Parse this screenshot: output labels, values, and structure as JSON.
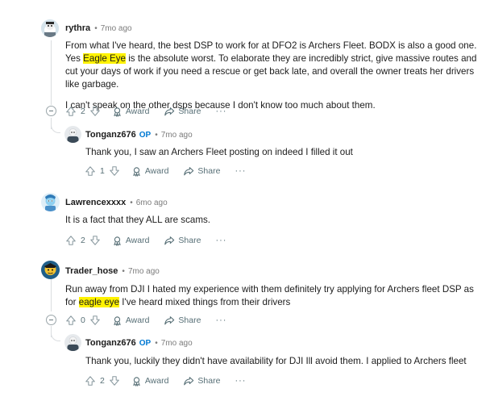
{
  "comments": [
    {
      "author": "rythra",
      "op": "",
      "time": "7mo ago",
      "paragraph1_before": "From what I've heard, the best DSP to work for at DFO2 is Archers Fleet. BODX is also a good one. Yes ",
      "paragraph1_highlight": "Eagle Eye",
      "paragraph1_after": " is the absolute worst. To elaborate they are incredibly strict, give massive routes and cut your days of work if you need a rescue or get back late, and overall the owner treats her drivers like garbage.",
      "paragraph2": "I can't speak on the other dsps because I don't know too much about them.",
      "votes": "2",
      "award_label": "Award",
      "share_label": "Share",
      "more_label": "···"
    },
    {
      "author": "Tonganz676",
      "op": "OP",
      "time": "7mo ago",
      "text": "Thank you, I saw an Archers Fleet posting on indeed I filled it out",
      "votes": "1",
      "award_label": "Award",
      "share_label": "Share",
      "more_label": "···"
    },
    {
      "author": "Lawrencexxxx",
      "op": "",
      "time": "6mo ago",
      "text": "It is a fact that they ALL are scams.",
      "votes": "2",
      "award_label": "Award",
      "share_label": "Share",
      "more_label": "···"
    },
    {
      "author": "Trader_hose",
      "op": "",
      "time": "7mo ago",
      "text_before": "Run away from DJI I hated my experience with them definitely try applying for Archers fleet DSP as for ",
      "text_highlight": "eagle eye",
      "text_after": " I've heard mixed things from their drivers",
      "votes": "0",
      "award_label": "Award",
      "share_label": "Share",
      "more_label": "···"
    },
    {
      "author": "Tonganz676",
      "op": "OP",
      "time": "7mo ago",
      "text": "Thank you, luckily they didn't have availability for DJI Ill avoid them. I applied to Archers fleet",
      "votes": "2",
      "award_label": "Award",
      "share_label": "Share",
      "more_label": "···"
    }
  ],
  "colors": {
    "highlight": "#fff200",
    "op_blue": "#0079d3",
    "meta_gray": "#7c7c7c",
    "action_gray": "#576f76",
    "thread_line": "#dadde0"
  },
  "icons": [
    "upvote-icon",
    "downvote-icon",
    "award-icon",
    "share-icon",
    "more-icon",
    "collapse-icon"
  ]
}
